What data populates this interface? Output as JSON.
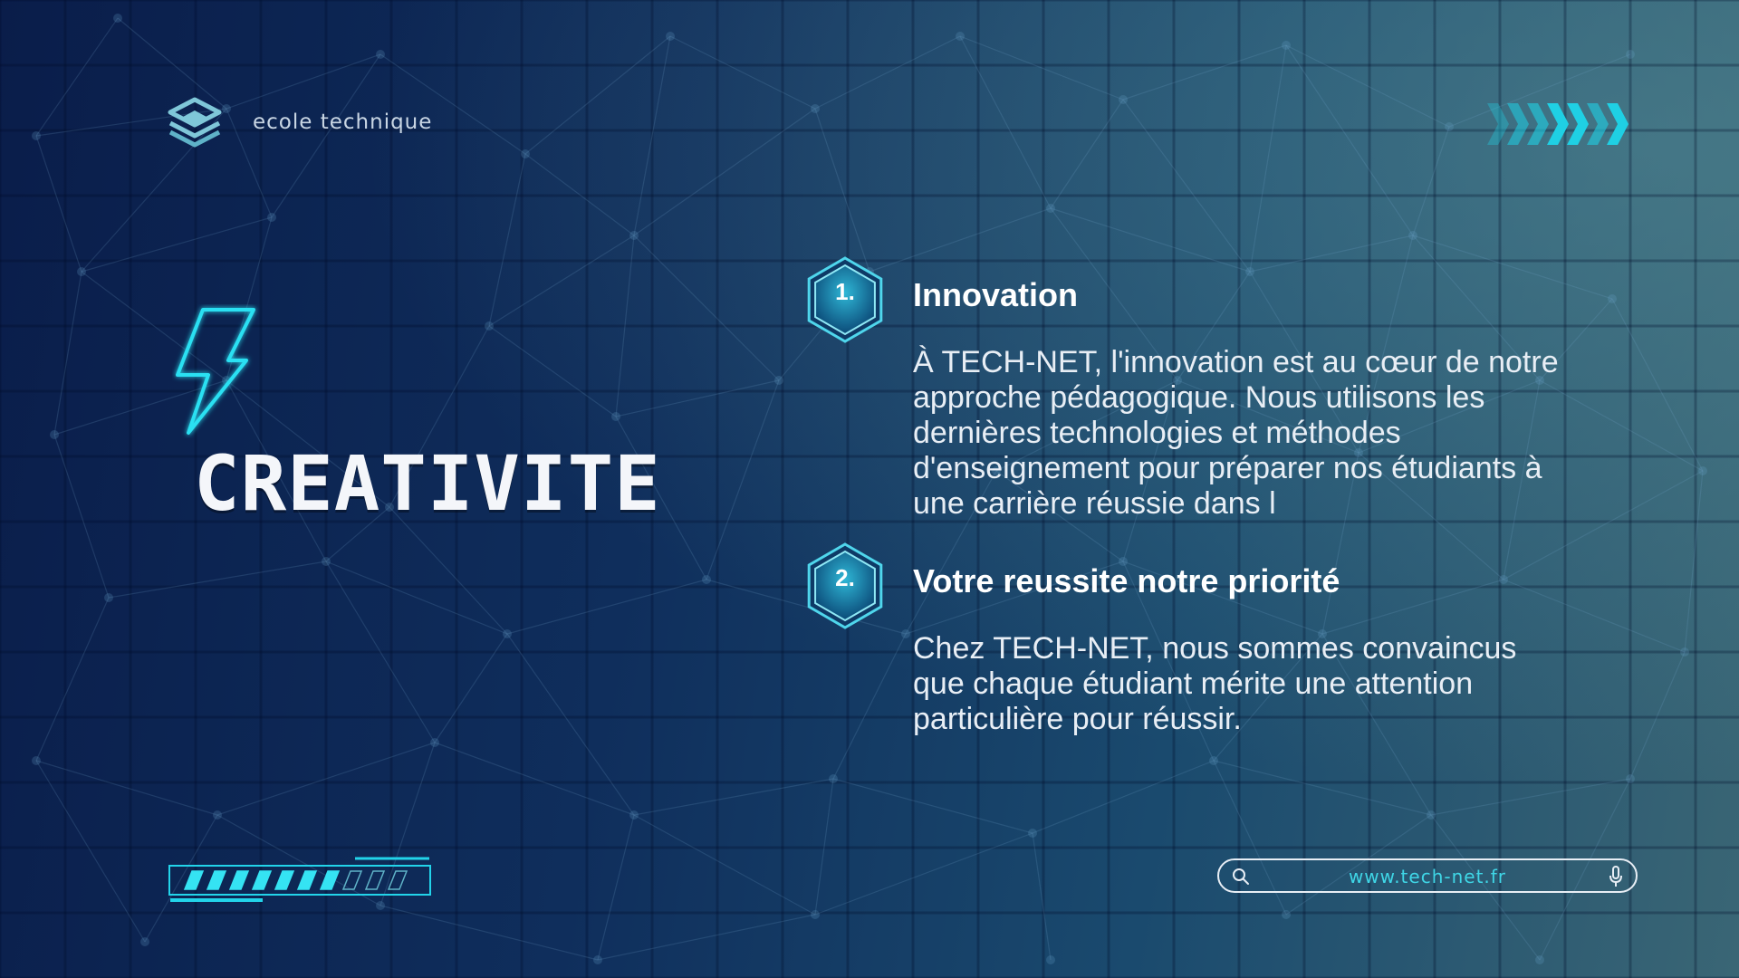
{
  "brand": {
    "name": "ecole technique",
    "logo_icon": "layered-cube-logo",
    "accent": "#22d4ea"
  },
  "headline": "CREATIVITE",
  "items": [
    {
      "number": "1.",
      "title": "Innovation",
      "body": "À TECH-NET, l'innovation est au cœur de notre approche pédagogique. Nous utilisons les dernières technologies et méthodes d'enseignement pour préparer nos étudiants à une carrière réussie dans l"
    },
    {
      "number": "2.",
      "title": "Votre reussite notre priorité",
      "body": "Chez TECH-NET, nous sommes convaincus que chaque étudiant mérite une attention particulière pour réussir."
    }
  ],
  "progress": {
    "filled_segments": 7,
    "total_segments": 10
  },
  "search_bar": {
    "url": "www.tech-net.fr",
    "left_icon": "search-icon",
    "right_icon": "mic-icon"
  },
  "colors": {
    "text": "#ffffff",
    "accent": "#22d4ea",
    "background_dark": "#0a1d4a",
    "background_light": "#3a6675"
  }
}
